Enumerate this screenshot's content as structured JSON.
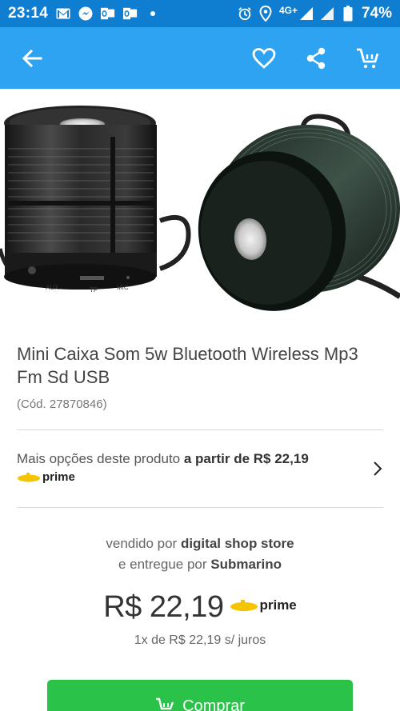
{
  "status_bar": {
    "time": "23:14",
    "network": "4G+",
    "battery": "74%",
    "icons_left": [
      "gmail-icon",
      "messenger-icon",
      "outlook-icon",
      "outlook-icon",
      "dot-icon"
    ],
    "icons_right": [
      "alarm-icon",
      "location-icon",
      "signal-icon",
      "signal-icon",
      "battery-icon"
    ]
  },
  "app_bar": {
    "color": "#2da3f2",
    "icons": [
      "back-arrow-icon",
      "heart-icon",
      "share-icon",
      "cart-icon"
    ]
  },
  "product": {
    "title": "Mini Caixa Som 5w Bluetooth Wireless Mp3 Fm Sd USB",
    "code": "(Cód. 27870846)",
    "image_labels": [
      "AUX",
      "TF",
      "MIC"
    ]
  },
  "more_options": {
    "text": "Mais opções deste produto ",
    "emphasis": "a partir de R$ 22,19",
    "prime_label": "prime"
  },
  "seller": {
    "sold_prefix": "vendido por ",
    "sold_by": "digital shop store",
    "delivered_prefix": "e entregue por ",
    "delivered_by": "Submarino"
  },
  "price": {
    "value": "R$ 22,19",
    "prime_label": "prime",
    "installments": "1x de R$ 22,19 s/ juros"
  },
  "buy_button": {
    "label": "Comprar",
    "color": "#2bc24a"
  }
}
